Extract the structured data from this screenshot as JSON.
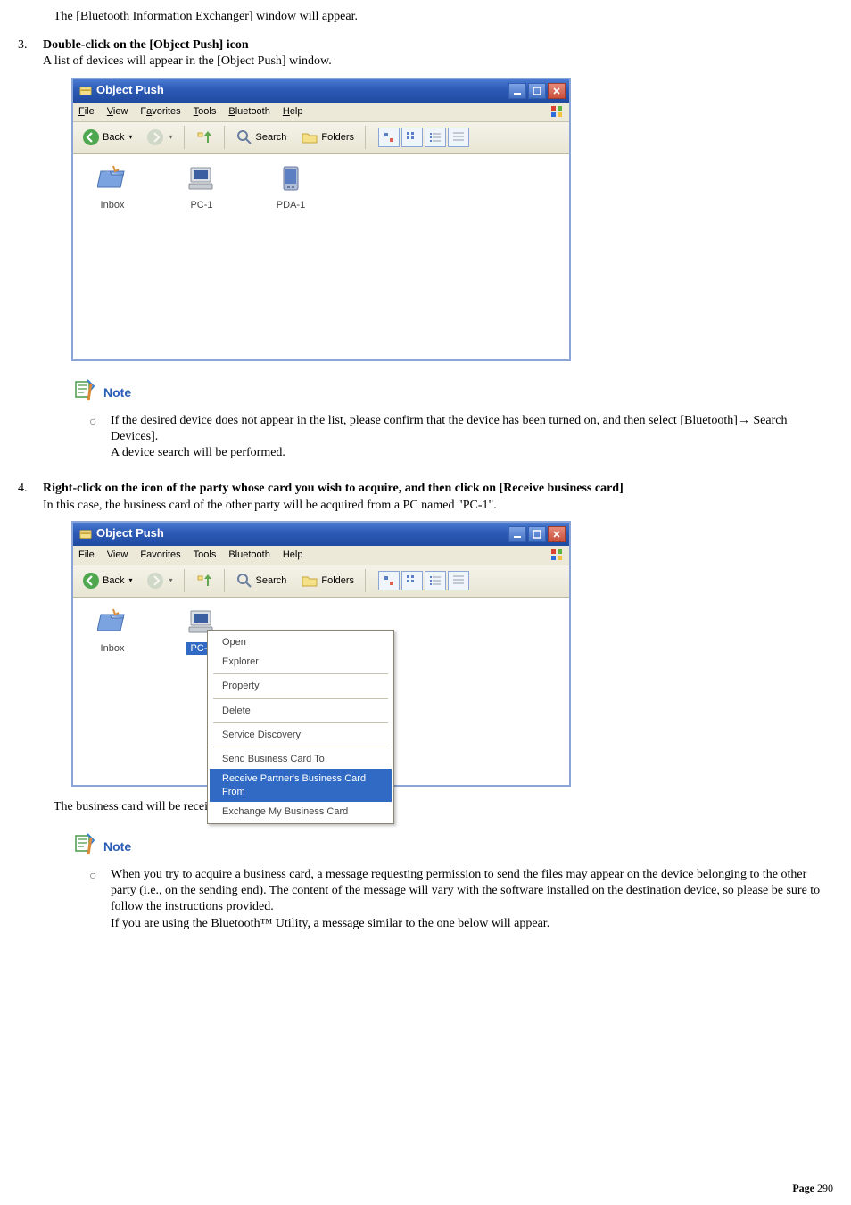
{
  "intro": "The [Bluetooth Information Exchanger] window will appear.",
  "step3": {
    "num": "3.",
    "title": "Double-click on the [Object Push] icon",
    "desc": "A list of devices will appear in the [Object Push] window."
  },
  "window": {
    "title": "Object Push",
    "menu": {
      "file": "File",
      "view": "View",
      "favorites": "Favorites",
      "tools": "Tools",
      "bluetooth": "Bluetooth",
      "help": "Help"
    },
    "toolbar": {
      "back": "Back",
      "search": "Search",
      "folders": "Folders"
    },
    "icons": {
      "inbox": "Inbox",
      "pc1": "PC-1",
      "pda1": "PDA-1"
    }
  },
  "note1": {
    "label": "Note",
    "line1": "If the desired device does not appear in the list, please confirm that the device has been turned on, and then select [Bluetooth]→ Search Devices].",
    "line2": "A device search will be performed."
  },
  "step4": {
    "num": "4.",
    "title": "Right-click on the icon of the party whose card you wish to acquire, and then click on [Receive business card]",
    "desc": "In this case, the business card of the other party will be acquired from a PC named \"PC-1\"."
  },
  "contextMenu": {
    "open": "Open",
    "explorer": "Explorer",
    "property": "Property",
    "delete": "Delete",
    "service": "Service Discovery",
    "send": "Send Business Card To",
    "receive": "Receive Partner's Business Card From",
    "exchange": "Exchange My Business Card"
  },
  "received": "The business card will be received.",
  "note2": {
    "label": "Note",
    "line1": "When you try to acquire a business card, a message requesting permission to send the files may appear on the device belonging to the other party (i.e., on the sending end). The content of the message will vary with the software installed on the destination device, so please be sure to follow the instructions provided.",
    "line2": "If you are using the Bluetooth™ Utility, a message similar to the one below will appear."
  },
  "footer": {
    "label": "Page ",
    "num": "290"
  }
}
